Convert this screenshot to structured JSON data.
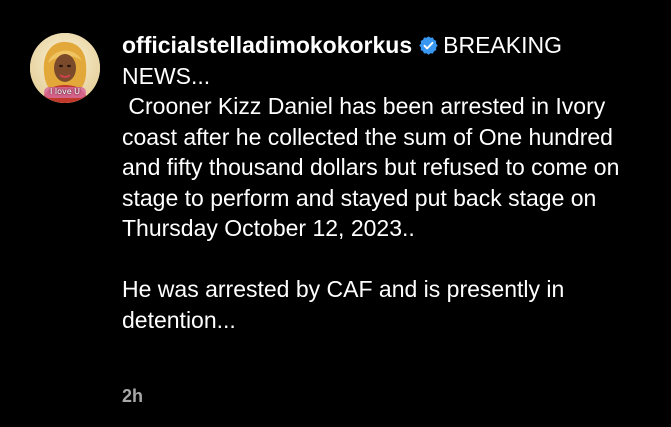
{
  "post": {
    "username": "officialstelladimokokorkus",
    "verified_icon": "verified-badge-icon",
    "avatar_caption": "I love U",
    "headline": "BREAKING NEWS...",
    "paragraph_1": " Crooner Kizz Daniel has been arrested in Ivory coast after he collected the sum of One hundred and fifty thousand dollars but refused to come on stage to perform and stayed put back stage on Thursday October 12, 2023..",
    "paragraph_2": "He was arrested by CAF and is presently in detention...",
    "timestamp": "2h"
  },
  "colors": {
    "background": "#000000",
    "text": "#ffffff",
    "muted": "#a8a8a8",
    "verified": "#3897f0"
  }
}
